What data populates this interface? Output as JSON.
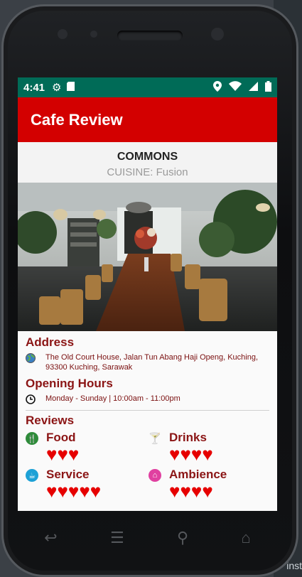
{
  "status_bar": {
    "time": "4:41"
  },
  "app_bar": {
    "title": "Cafe Review"
  },
  "cafe": {
    "name": "COMMONS",
    "cuisine": "CUISINE: Fusion"
  },
  "address": {
    "heading": "Address",
    "line1": "The Old Court House, Jalan Tun Abang Haji Openg, Kuching,",
    "line2": "93300 Kuching, Sarawak"
  },
  "hours": {
    "heading": "Opening Hours",
    "text": "Monday - Sunday | 10:00am - 11:00pm"
  },
  "reviews": {
    "heading": "Reviews",
    "categories": [
      {
        "label": "Food",
        "rating": 3,
        "icon": "food-icon",
        "color": "#2e8b3a"
      },
      {
        "label": "Drinks",
        "rating": 4,
        "icon": "cocktail-icon",
        "color": "#ff9800"
      },
      {
        "label": "Service",
        "rating": 5,
        "icon": "service-icon",
        "color": "#1da1d6"
      },
      {
        "label": "Ambience",
        "rating": 4,
        "icon": "ambience-icon",
        "color": "#e040a0"
      }
    ]
  },
  "host": {
    "text": "inst"
  },
  "colors": {
    "status_bar": "#006b57",
    "app_bar": "#d30000",
    "accent_text": "#8b1515",
    "heart": "#e60000"
  }
}
